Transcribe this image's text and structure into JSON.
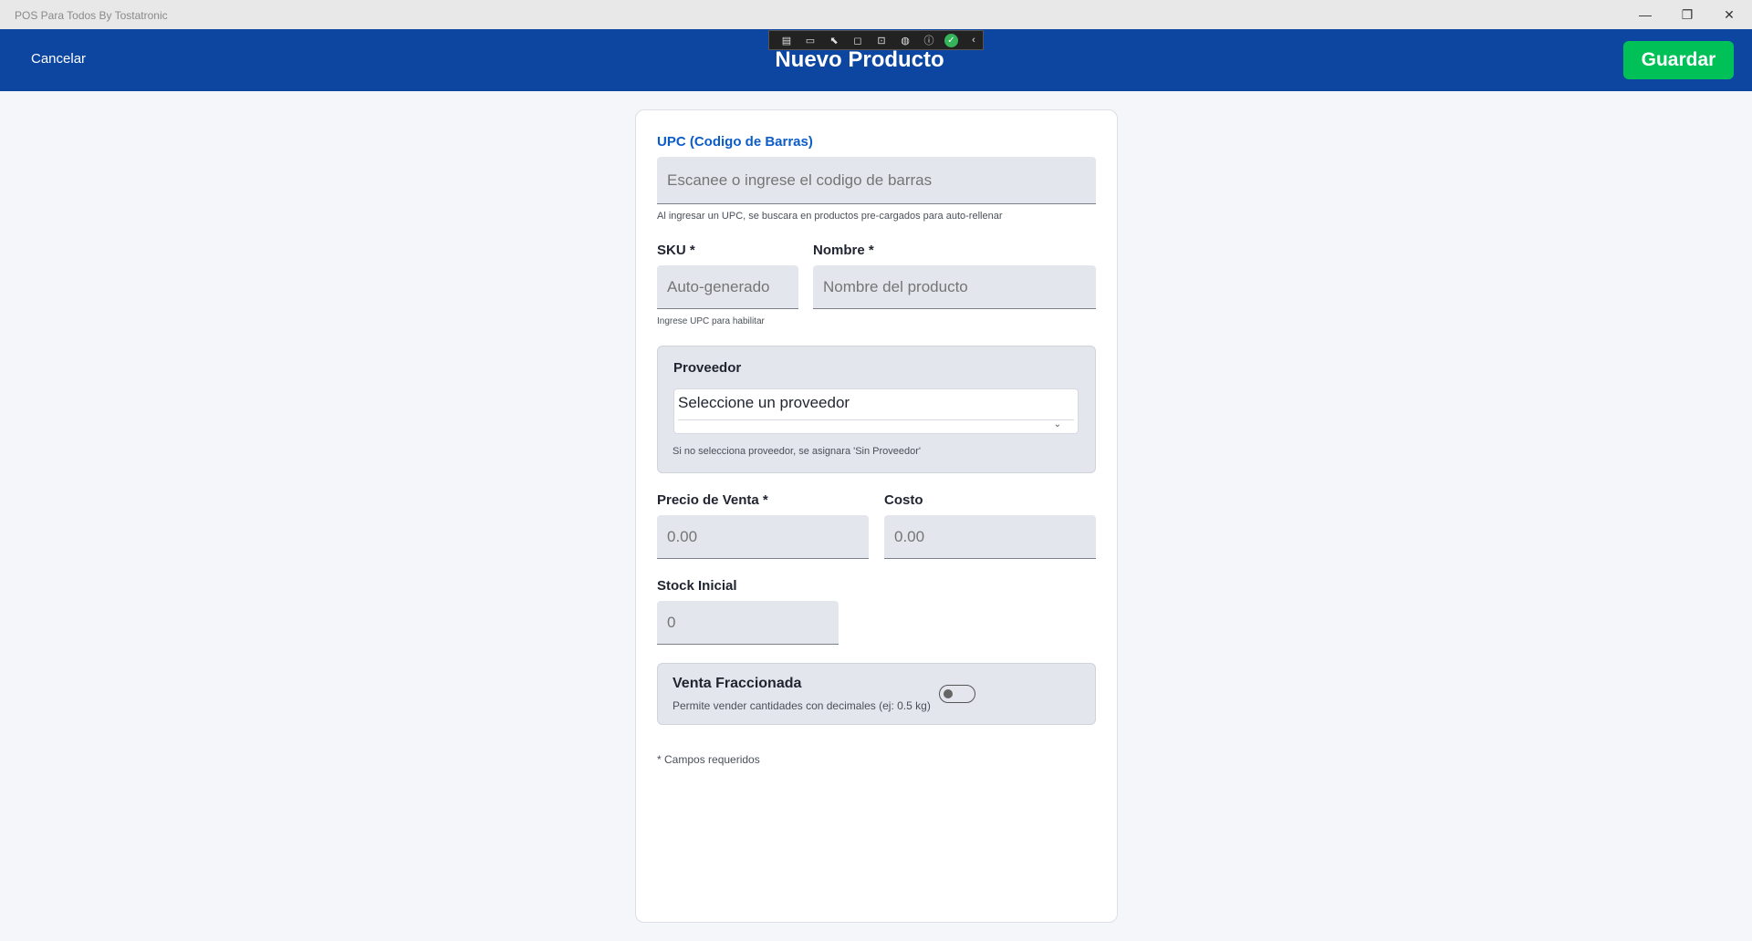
{
  "window": {
    "title": "POS Para Todos By Tostatronic",
    "minimize_glyph": "—",
    "restore_glyph": "❐",
    "close_glyph": "✕"
  },
  "header": {
    "cancel_label": "Cancelar",
    "title": "Nuevo Producto",
    "save_label": "Guardar"
  },
  "debug_toolbar": {
    "icons": [
      "live-tree-icon",
      "video-icon",
      "select-element-icon",
      "display-layout-icon",
      "track-focus-icon",
      "binding-icon",
      "accessibility-icon",
      "check-icon",
      "collapse-icon"
    ],
    "glyphs": [
      "▤",
      "▭",
      "⬉",
      "◻",
      "⊡",
      "◍",
      "ⓘ",
      "✓",
      "‹"
    ]
  },
  "form": {
    "upc": {
      "label": "UPC (Codigo de Barras)",
      "placeholder": "Escanee o ingrese el codigo de barras",
      "hint": "Al ingresar un UPC, se buscara en productos pre-cargados para auto-rellenar"
    },
    "sku": {
      "label": "SKU *",
      "placeholder": "Auto-generado",
      "hint": "Ingrese UPC para habilitar"
    },
    "name": {
      "label": "Nombre *",
      "placeholder": "Nombre del producto"
    },
    "supplier": {
      "label": "Proveedor",
      "selected": "Seleccione un proveedor",
      "hint": "Si no selecciona proveedor, se asignara 'Sin Proveedor'"
    },
    "price": {
      "label": "Precio de Venta *",
      "placeholder": "0.00"
    },
    "cost": {
      "label": "Costo",
      "placeholder": "0.00"
    },
    "stock": {
      "label": "Stock Inicial",
      "placeholder": "0"
    },
    "fractional": {
      "label": "Venta Fraccionada",
      "description": "Permite vender cantidades con decimales (ej: 0.5 kg)",
      "enabled": false
    },
    "required_note": "* Campos requeridos"
  },
  "colors": {
    "header_bg": "#0c46a0",
    "save_bg": "#00c058",
    "accent_label": "#0c5cc8"
  }
}
